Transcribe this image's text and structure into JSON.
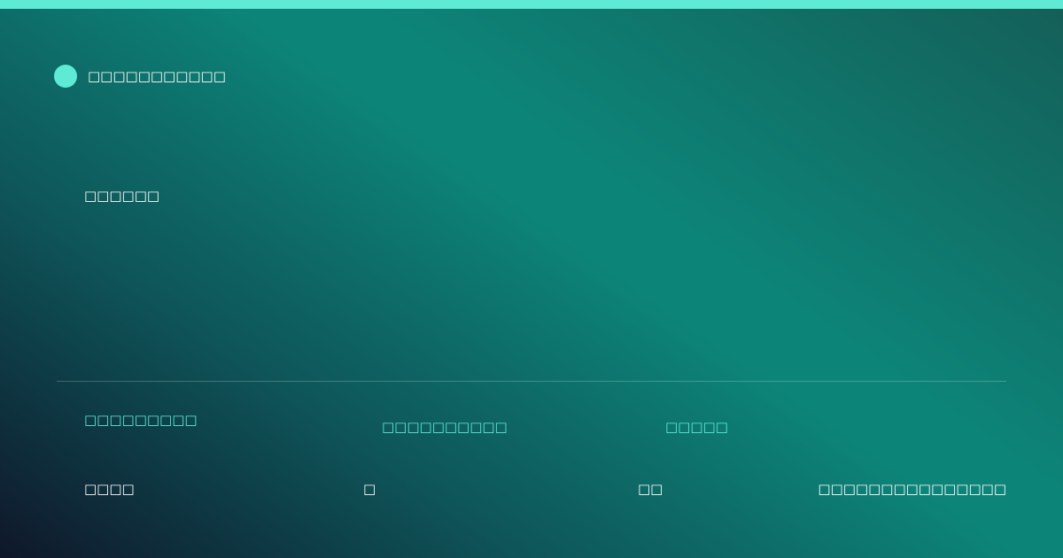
{
  "brand": {
    "name": "□□□□□□□□□□□",
    "accent_color": "#5eead4"
  },
  "headline": "□□□□□□",
  "stats": [
    {
      "label": "□□□□□□□□□",
      "value": "□□□□"
    },
    {
      "label": "□□□□□□□□□□",
      "value": "□"
    },
    {
      "label": "□□□□□",
      "value": "□□"
    }
  ],
  "footer": {
    "text": "□□□□□□□□□□□□□□□"
  },
  "colors": {
    "accent": "#5eead4",
    "background_start": "#0f172a",
    "background_mid": "#0d8478",
    "text": "#ffffff"
  }
}
